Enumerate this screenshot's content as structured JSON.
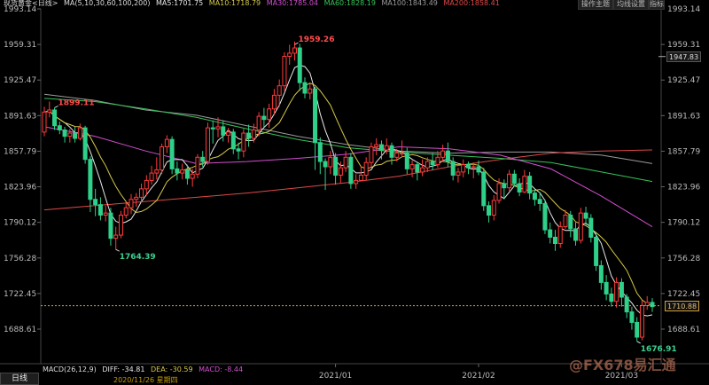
{
  "header": {
    "instrument": "现货黄金<日线>",
    "ma_params": "MA(5,10,30,60,100,200)",
    "ma_values": [
      {
        "label": "MA5:1701.75",
        "color": "#e8e8e8"
      },
      {
        "label": "MA10:1718.79",
        "color": "#d6c84a"
      },
      {
        "label": "MA30:1785.04",
        "color": "#d24fd0"
      },
      {
        "label": "MA60:1828.19",
        "color": "#38c25a"
      },
      {
        "label": "MA100:1843.49",
        "color": "#9a9a9a"
      },
      {
        "label": "MA200:1858.41",
        "color": "#e04848"
      }
    ],
    "buttons": [
      "操作主题",
      "均线设置",
      "指标"
    ]
  },
  "chart_data": {
    "type": "candlestick",
    "y_ticks": [
      "1993.14",
      "1959.31",
      "1925.47",
      "1891.63",
      "1857.79",
      "1823.96",
      "1790.12",
      "1756.28",
      "1722.45",
      "1688.61"
    ],
    "ylim": [
      1655,
      1995
    ],
    "x_ticks": [
      {
        "label": "2021/01",
        "index": 57
      },
      {
        "label": "2021/02",
        "index": 85
      },
      {
        "label": "2021/03",
        "index": 113
      }
    ],
    "candles": [
      [
        1876,
        1895,
        1900,
        1872
      ],
      [
        1895,
        1897,
        1905,
        1890
      ],
      [
        1897,
        1882,
        1899,
        1878
      ],
      [
        1882,
        1878,
        1886,
        1874
      ],
      [
        1878,
        1872,
        1881,
        1866
      ],
      [
        1872,
        1875,
        1879,
        1866
      ],
      [
        1875,
        1870,
        1881,
        1866
      ],
      [
        1870,
        1880,
        1884,
        1868
      ],
      [
        1880,
        1850,
        1882,
        1846
      ],
      [
        1850,
        1812,
        1853,
        1800
      ],
      [
        1812,
        1807,
        1822,
        1796
      ],
      [
        1807,
        1797,
        1814,
        1792
      ],
      [
        1797,
        1799,
        1806,
        1791
      ],
      [
        1799,
        1775,
        1804,
        1768
      ],
      [
        1775,
        1778,
        1786,
        1764
      ],
      [
        1778,
        1797,
        1801,
        1775
      ],
      [
        1797,
        1804,
        1810,
        1794
      ],
      [
        1804,
        1812,
        1817,
        1798
      ],
      [
        1812,
        1814,
        1818,
        1805
      ],
      [
        1814,
        1822,
        1827,
        1809
      ],
      [
        1822,
        1830,
        1835,
        1816
      ],
      [
        1830,
        1837,
        1844,
        1826
      ],
      [
        1837,
        1840,
        1852,
        1831
      ],
      [
        1840,
        1862,
        1865,
        1836
      ],
      [
        1862,
        1869,
        1873,
        1856
      ],
      [
        1869,
        1841,
        1872,
        1836
      ],
      [
        1841,
        1837,
        1848,
        1830
      ],
      [
        1837,
        1840,
        1846,
        1831
      ],
      [
        1840,
        1832,
        1845,
        1826
      ],
      [
        1832,
        1836,
        1841,
        1824
      ],
      [
        1836,
        1852,
        1855,
        1832
      ],
      [
        1852,
        1848,
        1858,
        1843
      ],
      [
        1848,
        1880,
        1885,
        1845
      ],
      [
        1880,
        1879,
        1887,
        1865
      ],
      [
        1879,
        1881,
        1890,
        1871
      ],
      [
        1881,
        1873,
        1887,
        1867
      ],
      [
        1873,
        1876,
        1880,
        1866
      ],
      [
        1876,
        1860,
        1879,
        1855
      ],
      [
        1860,
        1858,
        1866,
        1850
      ],
      [
        1858,
        1875,
        1879,
        1852
      ],
      [
        1875,
        1870,
        1883,
        1862
      ],
      [
        1870,
        1878,
        1884,
        1866
      ],
      [
        1878,
        1891,
        1895,
        1872
      ],
      [
        1891,
        1888,
        1899,
        1881
      ],
      [
        1888,
        1898,
        1903,
        1880
      ],
      [
        1898,
        1911,
        1917,
        1893
      ],
      [
        1911,
        1920,
        1926,
        1900
      ],
      [
        1920,
        1948,
        1952,
        1915
      ],
      [
        1948,
        1951,
        1959,
        1940
      ],
      [
        1951,
        1956,
        1962,
        1944
      ],
      [
        1956,
        1923,
        1960,
        1915
      ],
      [
        1923,
        1913,
        1928,
        1908
      ],
      [
        1913,
        1917,
        1922,
        1907
      ],
      [
        1917,
        1866,
        1919,
        1840
      ],
      [
        1866,
        1848,
        1871,
        1836
      ],
      [
        1848,
        1843,
        1851,
        1821
      ],
      [
        1843,
        1852,
        1858,
        1836
      ],
      [
        1852,
        1835,
        1856,
        1826
      ],
      [
        1835,
        1842,
        1848,
        1827
      ],
      [
        1842,
        1852,
        1858,
        1838
      ],
      [
        1852,
        1827,
        1856,
        1822
      ],
      [
        1827,
        1830,
        1836,
        1822
      ],
      [
        1830,
        1835,
        1844,
        1830
      ],
      [
        1835,
        1847,
        1852,
        1830
      ],
      [
        1847,
        1862,
        1866,
        1843
      ],
      [
        1862,
        1864,
        1870,
        1854
      ],
      [
        1864,
        1859,
        1868,
        1850
      ],
      [
        1859,
        1863,
        1870,
        1855
      ],
      [
        1863,
        1852,
        1866,
        1845
      ],
      [
        1852,
        1856,
        1860,
        1848
      ],
      [
        1856,
        1856,
        1868,
        1852
      ],
      [
        1856,
        1841,
        1861,
        1836
      ],
      [
        1841,
        1845,
        1849,
        1833
      ],
      [
        1845,
        1838,
        1848,
        1830
      ],
      [
        1838,
        1842,
        1850,
        1834
      ],
      [
        1842,
        1848,
        1852,
        1838
      ],
      [
        1848,
        1845,
        1856,
        1840
      ],
      [
        1845,
        1852,
        1858,
        1842
      ],
      [
        1852,
        1858,
        1864,
        1848
      ],
      [
        1858,
        1848,
        1866,
        1843
      ],
      [
        1848,
        1835,
        1852,
        1830
      ],
      [
        1835,
        1838,
        1842,
        1828
      ],
      [
        1838,
        1845,
        1850,
        1833
      ],
      [
        1845,
        1842,
        1848,
        1836
      ],
      [
        1842,
        1843,
        1847,
        1832
      ],
      [
        1843,
        1838,
        1849,
        1835
      ],
      [
        1838,
        1806,
        1842,
        1801
      ],
      [
        1806,
        1797,
        1810,
        1790
      ],
      [
        1797,
        1811,
        1816,
        1792
      ],
      [
        1811,
        1827,
        1832,
        1808
      ],
      [
        1827,
        1823,
        1831,
        1812
      ],
      [
        1823,
        1836,
        1840,
        1820
      ],
      [
        1836,
        1827,
        1840,
        1824
      ],
      [
        1827,
        1819,
        1832,
        1815
      ],
      [
        1819,
        1834,
        1840,
        1818
      ],
      [
        1834,
        1818,
        1838,
        1812
      ],
      [
        1818,
        1812,
        1822,
        1806
      ],
      [
        1812,
        1808,
        1819,
        1801
      ],
      [
        1808,
        1783,
        1812,
        1779
      ],
      [
        1783,
        1776,
        1790,
        1770
      ],
      [
        1776,
        1770,
        1783,
        1763
      ],
      [
        1770,
        1786,
        1791,
        1766
      ],
      [
        1786,
        1797,
        1802,
        1784
      ],
      [
        1797,
        1784,
        1801,
        1776
      ],
      [
        1784,
        1773,
        1790,
        1768
      ],
      [
        1773,
        1799,
        1804,
        1770
      ],
      [
        1799,
        1794,
        1805,
        1787
      ],
      [
        1794,
        1776,
        1798,
        1771
      ],
      [
        1776,
        1749,
        1780,
        1744
      ],
      [
        1749,
        1733,
        1754,
        1726
      ],
      [
        1733,
        1722,
        1740,
        1716
      ],
      [
        1722,
        1715,
        1728,
        1710
      ],
      [
        1715,
        1733,
        1738,
        1709
      ],
      [
        1733,
        1719,
        1737,
        1710
      ],
      [
        1719,
        1705,
        1722,
        1699
      ],
      [
        1705,
        1695,
        1710,
        1688
      ],
      [
        1695,
        1681,
        1700,
        1677
      ],
      [
        1681,
        1711,
        1716,
        1678
      ],
      [
        1711,
        1714,
        1720,
        1707
      ],
      [
        1714,
        1710,
        1718,
        1705
      ]
    ],
    "annotations": [
      {
        "label": "1899.11",
        "index": 2,
        "value": 1899.11,
        "color": "#ff4d4d",
        "pos": "above"
      },
      {
        "label": "1764.39",
        "index": 14,
        "value": 1764.39,
        "color": "#3cd090",
        "pos": "below"
      },
      {
        "label": "1959.26",
        "index": 49,
        "value": 1959.26,
        "color": "#ff4d4d",
        "pos": "above"
      },
      {
        "label": "1676.91",
        "index": 116,
        "value": 1676.91,
        "color": "#3cd090",
        "pos": "below"
      }
    ],
    "ma_colors": {
      "5": "#e8e8e8",
      "10": "#d6c84a",
      "30": "#d24fd0",
      "60": "#38c25a",
      "100": "#9a9a9a",
      "200": "#e04848"
    },
    "long_ma": {
      "100": [
        1912,
        1906,
        1897,
        1892,
        1882,
        1872,
        1864,
        1858,
        1856,
        1857,
        1857,
        1854,
        1846
      ],
      "200": [
        1802,
        1806,
        1810,
        1814,
        1818,
        1823,
        1828,
        1834,
        1843,
        1850,
        1856,
        1858,
        1859
      ],
      "60": [
        1908,
        1905,
        1898,
        1890,
        1879,
        1869,
        1861,
        1857,
        1854,
        1851,
        1847,
        1838,
        1829
      ],
      "30": [
        1881,
        1872,
        1858,
        1846,
        1848,
        1851,
        1855,
        1862,
        1860,
        1854,
        1841,
        1815,
        1786
      ]
    },
    "last_price": 1710.88,
    "last_price_label": "1710.88",
    "right_marker": "1947.83",
    "right_marker_value": 1947.83
  },
  "footer": {
    "macd_title": "MACD(26,12,9)",
    "diff": "DIFF: -34.81",
    "dea": "DEA: -30.59",
    "macd": "MACD: -8.44",
    "date_label": "2020/11/26 星期四",
    "period_label": "日线",
    "watermark": "@FX678易汇通"
  }
}
